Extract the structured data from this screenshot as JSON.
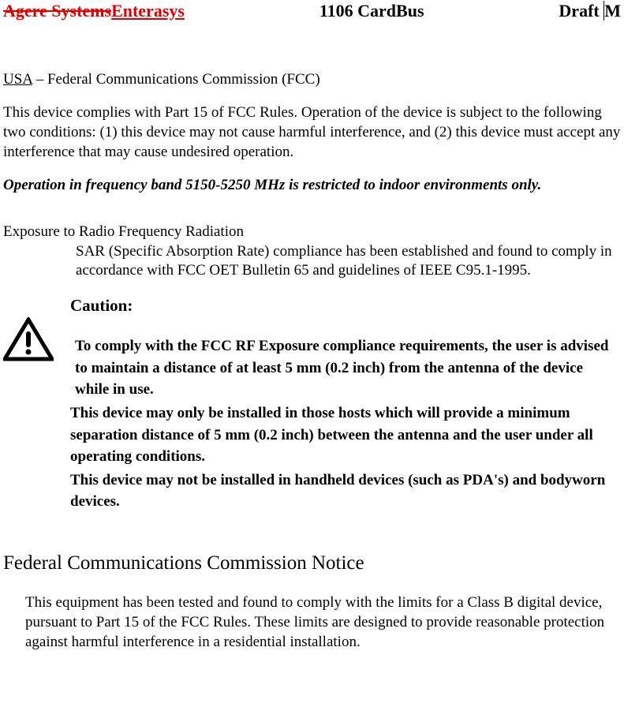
{
  "header": {
    "strike": "Agere Systems",
    "insert": "Enterasys",
    "center": "1106 CardBus",
    "right_pre": "Draft ",
    "right_post": "M"
  },
  "usa": {
    "label": "USA",
    "rest": " – Federal Communications Commission (FCC)"
  },
  "compliance_para": "This device complies with Part 15 of FCC Rules. Operation of the device is subject to the following two conditions: (1) this device may not cause harmful interference, and (2) this device must accept any interference that may cause undesired operation.",
  "freq_restrict": "Operation in frequency band 5150-5250 MHz is restricted to indoor environments only.",
  "exposure": {
    "title": "Exposure to Radio Frequency Radiation",
    "body": "SAR (Specific Absorption Rate) compliance has been established and found to comply in accordance with FCC OET Bulletin 65 and guidelines of IEEE C95.1-1995."
  },
  "caution": {
    "title": "Caution:",
    "p1": "To comply with the FCC RF Exposure compliance requirements, the user is advised to maintain a distance of at least 5 mm (0.2 inch) from the antenna of the device while in use.",
    "p2": "This device may only be installed in those hosts which will provide a minimum separation distance of 5 mm (0.2 inch) between the antenna and the user under all operating conditions.",
    "p3": "This device may not be installed in handheld devices (such as PDA's) and bodyworn devices."
  },
  "fcc_notice": {
    "heading": "Federal Communications Commission Notice",
    "body": "This equipment has been tested and found to comply with the limits for a Class B digital device, pursuant to Part 15 of the FCC Rules. These limits are designed to provide reasonable protection against harmful interference in a residential installation."
  }
}
